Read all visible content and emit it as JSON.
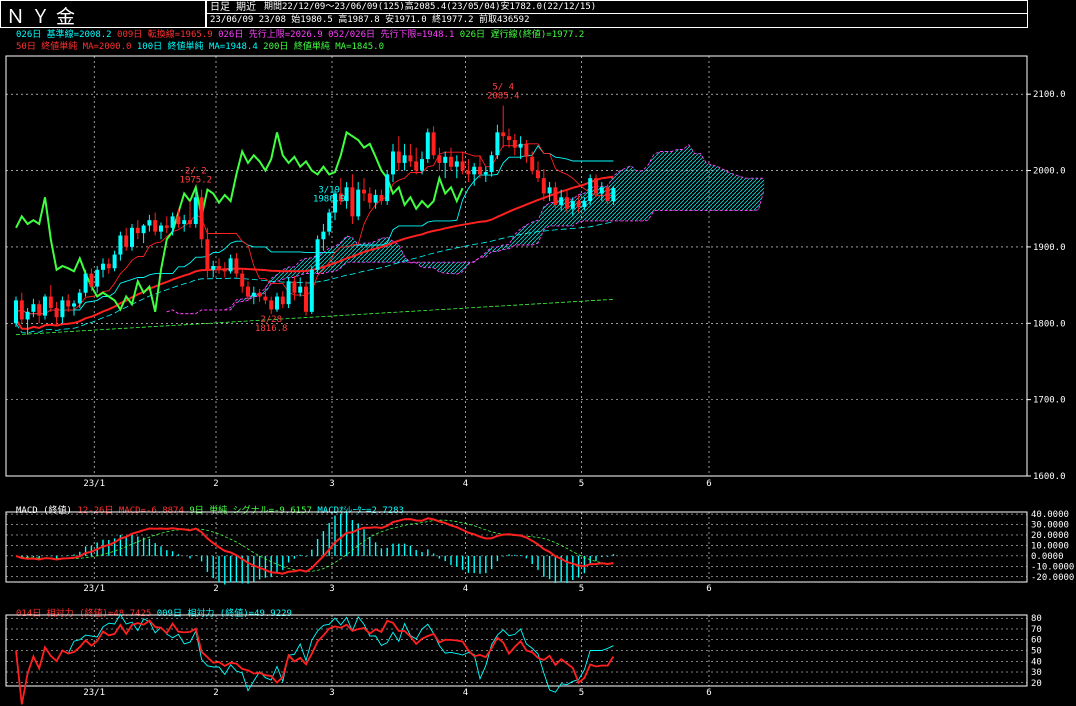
{
  "header": {
    "title": "ＮＹ金",
    "mode": "日足 期近",
    "period_line": "期間22/12/09～23/06/09(125)高2085.4(23/05/04)安1782.0(22/12/15)",
    "ohlc_line": "23/06/09 23/08 始1980.5 高1987.8 安1971.0 終1977.2 前取436592"
  },
  "legend": {
    "row1": [
      {
        "text": "026日 基準線=2008.2",
        "color": "#00ffff"
      },
      {
        "text": "009日 転換線=1965.9",
        "color": "#ff3030"
      },
      {
        "text": "026日 先行上限=2026.9",
        "color": "#ff40ff"
      },
      {
        "text": "052/026日 先行下限=1948.1",
        "color": "#ff40ff"
      },
      {
        "text": "026日 遅行線(終値)=1977.2",
        "color": "#40ff40"
      }
    ],
    "row2": [
      {
        "text": "50日 終値単純 MA=2000.0",
        "color": "#ff3030"
      },
      {
        "text": "100日 終値単純 MA=1948.4",
        "color": "#00ffff"
      },
      {
        "text": "200日 終値単純 MA=1845.0",
        "color": "#40ff40"
      }
    ],
    "macd": [
      {
        "text": "MACD (終値)",
        "color": "#ffffff"
      },
      {
        "text": "12-26日 MACD=-6.8874",
        "color": "#ff3030"
      },
      {
        "text": "9日 単純 シグナル=-9.6157",
        "color": "#40ff40"
      },
      {
        "text": "MACDｵｼﾚｰﾀｰ=2.7283",
        "color": "#00ffff"
      }
    ],
    "rsi": [
      {
        "text": "014日 相対力 (終値)=48.7425",
        "color": "#ff3030"
      },
      {
        "text": "009日 相対力 (終値)=49.9229",
        "color": "#00ffff"
      }
    ]
  },
  "chart_data": [
    {
      "type": "candlestick",
      "title": "ＮＹ金",
      "ylim": [
        1600,
        2150
      ],
      "yticks": [
        "1600.0",
        "1700.0",
        "1800.0",
        "1900.0",
        "2000.0",
        "2100.0"
      ],
      "xticks": [
        "23/1",
        "2",
        "3",
        "4",
        "5",
        "6"
      ],
      "grid": true,
      "annotations": [
        {
          "text": "2/ 2",
          "sub": "1975.2"
        },
        {
          "text": "2/28",
          "sub": "1816.8"
        },
        {
          "text": "3/19",
          "sub": "1980.9"
        },
        {
          "text": "5/ 4",
          "sub": "2085.4"
        }
      ],
      "candles": [
        [
          1800,
          1835,
          1795,
          1830
        ],
        [
          1830,
          1840,
          1800,
          1805
        ],
        [
          1805,
          1820,
          1785,
          1815
        ],
        [
          1815,
          1832,
          1808,
          1825
        ],
        [
          1825,
          1830,
          1800,
          1810
        ],
        [
          1810,
          1838,
          1805,
          1835
        ],
        [
          1835,
          1850,
          1815,
          1820
        ],
        [
          1820,
          1828,
          1798,
          1808
        ],
        [
          1808,
          1835,
          1800,
          1830
        ],
        [
          1830,
          1838,
          1815,
          1822
        ],
        [
          1822,
          1830,
          1810,
          1826
        ],
        [
          1826,
          1845,
          1820,
          1840
        ],
        [
          1840,
          1870,
          1835,
          1865
        ],
        [
          1865,
          1872,
          1842,
          1848
        ],
        [
          1848,
          1875,
          1840,
          1870
        ],
        [
          1870,
          1885,
          1860,
          1878
        ],
        [
          1878,
          1885,
          1865,
          1872
        ],
        [
          1872,
          1895,
          1868,
          1890
        ],
        [
          1890,
          1920,
          1882,
          1915
        ],
        [
          1915,
          1925,
          1895,
          1900
        ],
        [
          1900,
          1930,
          1895,
          1925
        ],
        [
          1925,
          1935,
          1910,
          1918
        ],
        [
          1918,
          1930,
          1905,
          1928
        ],
        [
          1928,
          1942,
          1920,
          1935
        ],
        [
          1935,
          1945,
          1915,
          1920
        ],
        [
          1920,
          1932,
          1910,
          1928
        ],
        [
          1928,
          1940,
          1918,
          1925
        ],
        [
          1925,
          1945,
          1915,
          1940
        ],
        [
          1940,
          1950,
          1925,
          1930
        ],
        [
          1930,
          1942,
          1920,
          1935
        ],
        [
          1935,
          1960,
          1925,
          1930
        ],
        [
          1930,
          1975,
          1925,
          1965
        ],
        [
          1965,
          1975,
          1900,
          1910
        ],
        [
          1910,
          1925,
          1860,
          1870
        ],
        [
          1870,
          1882,
          1860,
          1875
        ],
        [
          1875,
          1885,
          1865,
          1872
        ],
        [
          1872,
          1880,
          1860,
          1868
        ],
        [
          1868,
          1890,
          1865,
          1885
        ],
        [
          1885,
          1892,
          1860,
          1865
        ],
        [
          1865,
          1870,
          1840,
          1848
        ],
        [
          1848,
          1855,
          1830,
          1835
        ],
        [
          1835,
          1848,
          1825,
          1840
        ],
        [
          1840,
          1845,
          1828,
          1835
        ],
        [
          1835,
          1848,
          1825,
          1830
        ],
        [
          1830,
          1835,
          1812,
          1818
        ],
        [
          1818,
          1840,
          1815,
          1835
        ],
        [
          1835,
          1842,
          1820,
          1825
        ],
        [
          1825,
          1860,
          1820,
          1855
        ],
        [
          1855,
          1862,
          1830,
          1840
        ],
        [
          1840,
          1860,
          1835,
          1848
        ],
        [
          1848,
          1855,
          1810,
          1815
        ],
        [
          1815,
          1875,
          1812,
          1870
        ],
        [
          1870,
          1915,
          1865,
          1910
        ],
        [
          1910,
          1930,
          1895,
          1920
        ],
        [
          1920,
          1950,
          1915,
          1945
        ],
        [
          1945,
          1975,
          1935,
          1970
        ],
        [
          1970,
          1990,
          1955,
          1960
        ],
        [
          1960,
          1985,
          1950,
          1978
        ],
        [
          1978,
          1995,
          1930,
          1940
        ],
        [
          1940,
          1985,
          1935,
          1975
        ],
        [
          1975,
          1990,
          1960,
          1970
        ],
        [
          1970,
          1978,
          1950,
          1958
        ],
        [
          1958,
          1975,
          1950,
          1968
        ],
        [
          1968,
          1975,
          1955,
          1960
        ],
        [
          1960,
          2000,
          1955,
          1995
        ],
        [
          1995,
          2035,
          1985,
          2025
        ],
        [
          2025,
          2045,
          2000,
          2010
        ],
        [
          2010,
          2035,
          2000,
          2020
        ],
        [
          2020,
          2035,
          2005,
          2012
        ],
        [
          2012,
          2030,
          1995,
          2000
        ],
        [
          2000,
          2025,
          1995,
          2015
        ],
        [
          2015,
          2055,
          2010,
          2050
        ],
        [
          2050,
          2058,
          2015,
          2020
        ],
        [
          2020,
          2030,
          2000,
          2010
        ],
        [
          2010,
          2025,
          1990,
          2018
        ],
        [
          2018,
          2030,
          2000,
          2005
        ],
        [
          2005,
          2020,
          1990,
          2012
        ],
        [
          2012,
          2025,
          1995,
          2000
        ],
        [
          2000,
          2015,
          1985,
          1995
        ],
        [
          1995,
          2010,
          1980,
          2005
        ],
        [
          2005,
          2020,
          1990,
          1995
        ],
        [
          1995,
          2005,
          1985,
          1998
        ],
        [
          1998,
          2025,
          1992,
          2020
        ],
        [
          2020,
          2060,
          2015,
          2050
        ],
        [
          2050,
          2085,
          2030,
          2045
        ],
        [
          2045,
          2055,
          2030,
          2040
        ],
        [
          2040,
          2048,
          2020,
          2030
        ],
        [
          2030,
          2045,
          2015,
          2035
        ],
        [
          2035,
          2040,
          2010,
          2018
        ],
        [
          2018,
          2025,
          1995,
          2000
        ],
        [
          2000,
          2012,
          1985,
          1990
        ],
        [
          1990,
          2002,
          1960,
          1970
        ],
        [
          1970,
          1985,
          1960,
          1978
        ],
        [
          1978,
          1985,
          1950,
          1955
        ],
        [
          1955,
          1975,
          1948,
          1965
        ],
        [
          1965,
          1975,
          1945,
          1950
        ],
        [
          1950,
          1965,
          1940,
          1960
        ],
        [
          1960,
          1968,
          1945,
          1952
        ],
        [
          1952,
          1965,
          1948,
          1960
        ],
        [
          1960,
          1995,
          1955,
          1990
        ],
        [
          1990,
          1995,
          1965,
          1970
        ],
        [
          1970,
          1985,
          1960,
          1978
        ],
        [
          1978,
          1982,
          1955,
          1960
        ],
        [
          1960,
          1980,
          1955,
          1977
        ]
      ]
    },
    {
      "type": "line",
      "title": "MACD (終値)",
      "ylim": [
        -25,
        42
      ],
      "yticks": [
        "40.0000",
        "30.0000",
        "20.0000",
        "10.0000",
        "0.0000",
        "-10.0000",
        "-20.0000"
      ]
    },
    {
      "type": "line",
      "title": "相対力",
      "ylim": [
        17,
        83
      ],
      "yticks": [
        "80",
        "70",
        "60",
        "50",
        "40",
        "30",
        "20"
      ]
    }
  ],
  "colors": {
    "bull": "#00ffff",
    "bear": "#ff2020",
    "kijun": "#00ffff",
    "tenkan": "#ff2020",
    "span": "#ff40ff",
    "chikou": "#40ff40",
    "ma50": "#ff2020",
    "ma100": "#00ffff",
    "ma200": "#40ff40",
    "grid": "#ffffff"
  }
}
